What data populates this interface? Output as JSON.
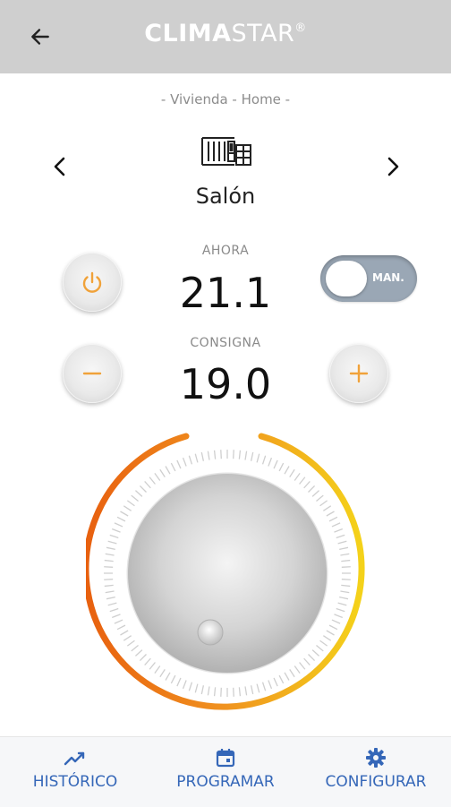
{
  "header": {
    "title_bold": "CLIMA",
    "title_light": "STAR",
    "title_mark": "®",
    "back_icon": "arrow-left-icon"
  },
  "breadcrumb": "- Vivienda - Home -",
  "room": {
    "name": "Salón",
    "icon": "radiator-icon",
    "prev_icon": "chevron-left-icon",
    "next_icon": "chevron-right-icon"
  },
  "readings": {
    "current_label": "AHORA",
    "current_value": "21.1",
    "setpoint_label": "CONSIGNA",
    "setpoint_value": "19.0"
  },
  "controls": {
    "power_icon": "power-icon",
    "minus_icon": "minus-icon",
    "plus_icon": "plus-icon",
    "mode_label": "MAN.",
    "mode_on": false,
    "accent_color": "#f0a23a"
  },
  "dial": {
    "gradient_start": "#e8600f",
    "gradient_end": "#f4d21a",
    "knob_icon": "dial-knob-icon"
  },
  "bottom_nav": [
    {
      "label": "HISTÓRICO",
      "icon": "chart-trend-icon"
    },
    {
      "label": "PROGRAMAR",
      "icon": "calendar-icon"
    },
    {
      "label": "CONFIGURAR",
      "icon": "gear-icon"
    }
  ],
  "nav_color": "#3567b8"
}
